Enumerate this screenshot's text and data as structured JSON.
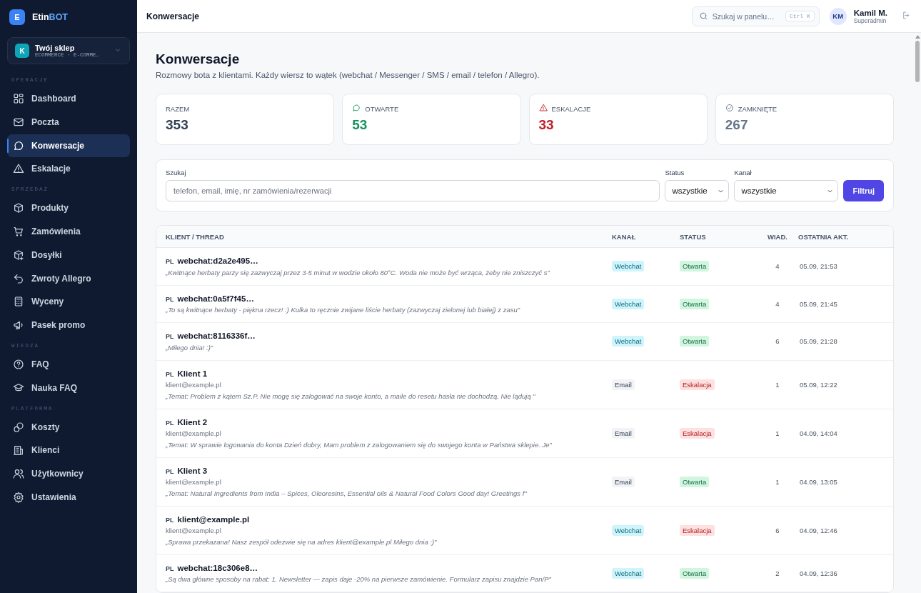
{
  "brand": {
    "initial": "E",
    "name_a": "Etin",
    "name_b": "BOT"
  },
  "store": {
    "initial": "K",
    "name": "Twój sklep",
    "meta": "ECOMMERCE · E-COMME…"
  },
  "sidebar": [
    {
      "section": "OPERACJE",
      "items": [
        {
          "label": "Dashboard",
          "selected": false
        },
        {
          "label": "Poczta",
          "selected": false
        },
        {
          "label": "Konwersacje",
          "selected": true
        },
        {
          "label": "Eskalacje",
          "selected": false
        }
      ]
    },
    {
      "section": "SPRZEDAŻ",
      "items": [
        {
          "label": "Produkty",
          "selected": false
        },
        {
          "label": "Zamówienia",
          "selected": false
        },
        {
          "label": "Dosyłki",
          "selected": false
        },
        {
          "label": "Zwroty Allegro",
          "selected": false
        },
        {
          "label": "Wyceny",
          "selected": false
        },
        {
          "label": "Pasek promo",
          "selected": false
        }
      ]
    },
    {
      "section": "WIEDZA",
      "items": [
        {
          "label": "FAQ",
          "selected": false
        },
        {
          "label": "Nauka FAQ",
          "selected": false
        }
      ]
    },
    {
      "section": "PLATFORMA",
      "items": [
        {
          "label": "Koszty",
          "selected": false
        },
        {
          "label": "Klienci",
          "selected": false
        },
        {
          "label": "Użytkownicy",
          "selected": false
        },
        {
          "label": "Ustawienia",
          "selected": false
        }
      ]
    }
  ],
  "topbar": {
    "title": "Konwersacje",
    "search_placeholder": "Szukaj w panelu…",
    "shortcut": "Ctrl K",
    "user_initials": "KM",
    "user_name": "Kamil M.",
    "user_role": "Superadmin"
  },
  "page": {
    "title": "Konwersacje",
    "subtitle": "Rozmowy bota z klientami. Każdy wiersz to wątek (webchat / Messenger / SMS / email / telefon / Allegro)."
  },
  "stats": [
    {
      "kind": "total",
      "label": "RAZEM",
      "value": "353"
    },
    {
      "kind": "open",
      "label": "OTWARTE",
      "value": "53"
    },
    {
      "kind": "escalation",
      "label": "ESKALACJE",
      "value": "33"
    },
    {
      "kind": "closed",
      "label": "ZAMKNIĘTE",
      "value": "267"
    }
  ],
  "filters": {
    "search_label": "Szukaj",
    "search_placeholder": "telefon, email, imię, nr zamówienia/rezerwacji",
    "status_label": "Status",
    "status_value": "wszystkie",
    "channel_label": "Kanał",
    "channel_value": "wszystkie",
    "button": "Filtruj"
  },
  "table": {
    "columns": [
      "KLIENT / THREAD",
      "KANAŁ",
      "STATUS",
      "WIAD.",
      "OSTATNIA AKT."
    ],
    "rows": [
      {
        "lang": "PL",
        "title": "webchat:d2a2e495…",
        "preview": "„Kwitnące herbaty parzy się zazwyczaj przez 3-5 minut w wodzie około 80°C. Woda nie może być wrząca, żeby nie zniszczyć s\"",
        "channel": {
          "kind": "webchat",
          "label": "Webchat"
        },
        "status": {
          "kind": "open",
          "label": "Otwarta"
        },
        "count": "4",
        "last": "05.09, 21:53"
      },
      {
        "lang": "PL",
        "title": "webchat:0a5f7f45…",
        "preview": "„To są kwitnące herbaty - piękna rzecz! :) Kulka to ręcznie zwijane liście herbaty (zazwyczaj zielonej lub białej) z zasu\"",
        "channel": {
          "kind": "webchat",
          "label": "Webchat"
        },
        "status": {
          "kind": "open",
          "label": "Otwarta"
        },
        "count": "4",
        "last": "05.09, 21:45"
      },
      {
        "lang": "PL",
        "title": "webchat:8116336f…",
        "preview": "„Miłego dnia! :)\"",
        "channel": {
          "kind": "webchat",
          "label": "Webchat"
        },
        "status": {
          "kind": "open",
          "label": "Otwarta"
        },
        "count": "6",
        "last": "05.09, 21:28"
      },
      {
        "lang": "PL",
        "title": "Klient 1",
        "email": "klient@example.pl",
        "preview": "„Temat: Problem z kątem Sz.P. Nie mogę się zalogować na swoje konto, a maile do resetu hasła nie dochodzą. Nie lądują \"",
        "channel": {
          "kind": "email",
          "label": "Email"
        },
        "status": {
          "kind": "escalation",
          "label": "Eskalacja"
        },
        "count": "1",
        "last": "05.09, 12:22"
      },
      {
        "lang": "PL",
        "title": "Klient 2",
        "email": "klient@example.pl",
        "preview": "„Temat: W sprawie logowania do konta Dzień dobry, Mam problem z zalogowaniem się do swojego konta w Państwa sklepie. Je\"",
        "channel": {
          "kind": "email",
          "label": "Email"
        },
        "status": {
          "kind": "escalation",
          "label": "Eskalacja"
        },
        "count": "1",
        "last": "04.09, 14:04"
      },
      {
        "lang": "PL",
        "title": "Klient 3",
        "email": "klient@example.pl",
        "preview": "„Temat: Natural Ingredients from India – Spices, Oleoresins, Essential oils & Natural Food Colors Good day! Greetings f\"",
        "channel": {
          "kind": "email",
          "label": "Email"
        },
        "status": {
          "kind": "open",
          "label": "Otwarta"
        },
        "count": "1",
        "last": "04.09, 13:05"
      },
      {
        "lang": "PL",
        "title": "klient@example.pl",
        "email": "klient@example.pl",
        "preview": "„Sprawa przekazana! Nasz zespół odezwie się na adres klient@example.pl Miłego dnia :)\"",
        "channel": {
          "kind": "webchat",
          "label": "Webchat"
        },
        "status": {
          "kind": "escalation",
          "label": "Eskalacja"
        },
        "count": "6",
        "last": "04.09, 12:46"
      },
      {
        "lang": "PL",
        "title": "webchat:18c306e8…",
        "preview": "„Są dwa główne sposoby na rabat: 1. Newsletter — zapis daje -20% na pierwsze zamówienie. Formularz zapisu znajdzie Pan/P\"",
        "channel": {
          "kind": "webchat",
          "label": "Webchat"
        },
        "status": {
          "kind": "open",
          "label": "Otwarta"
        },
        "count": "2",
        "last": "04.09, 12:36"
      }
    ]
  }
}
